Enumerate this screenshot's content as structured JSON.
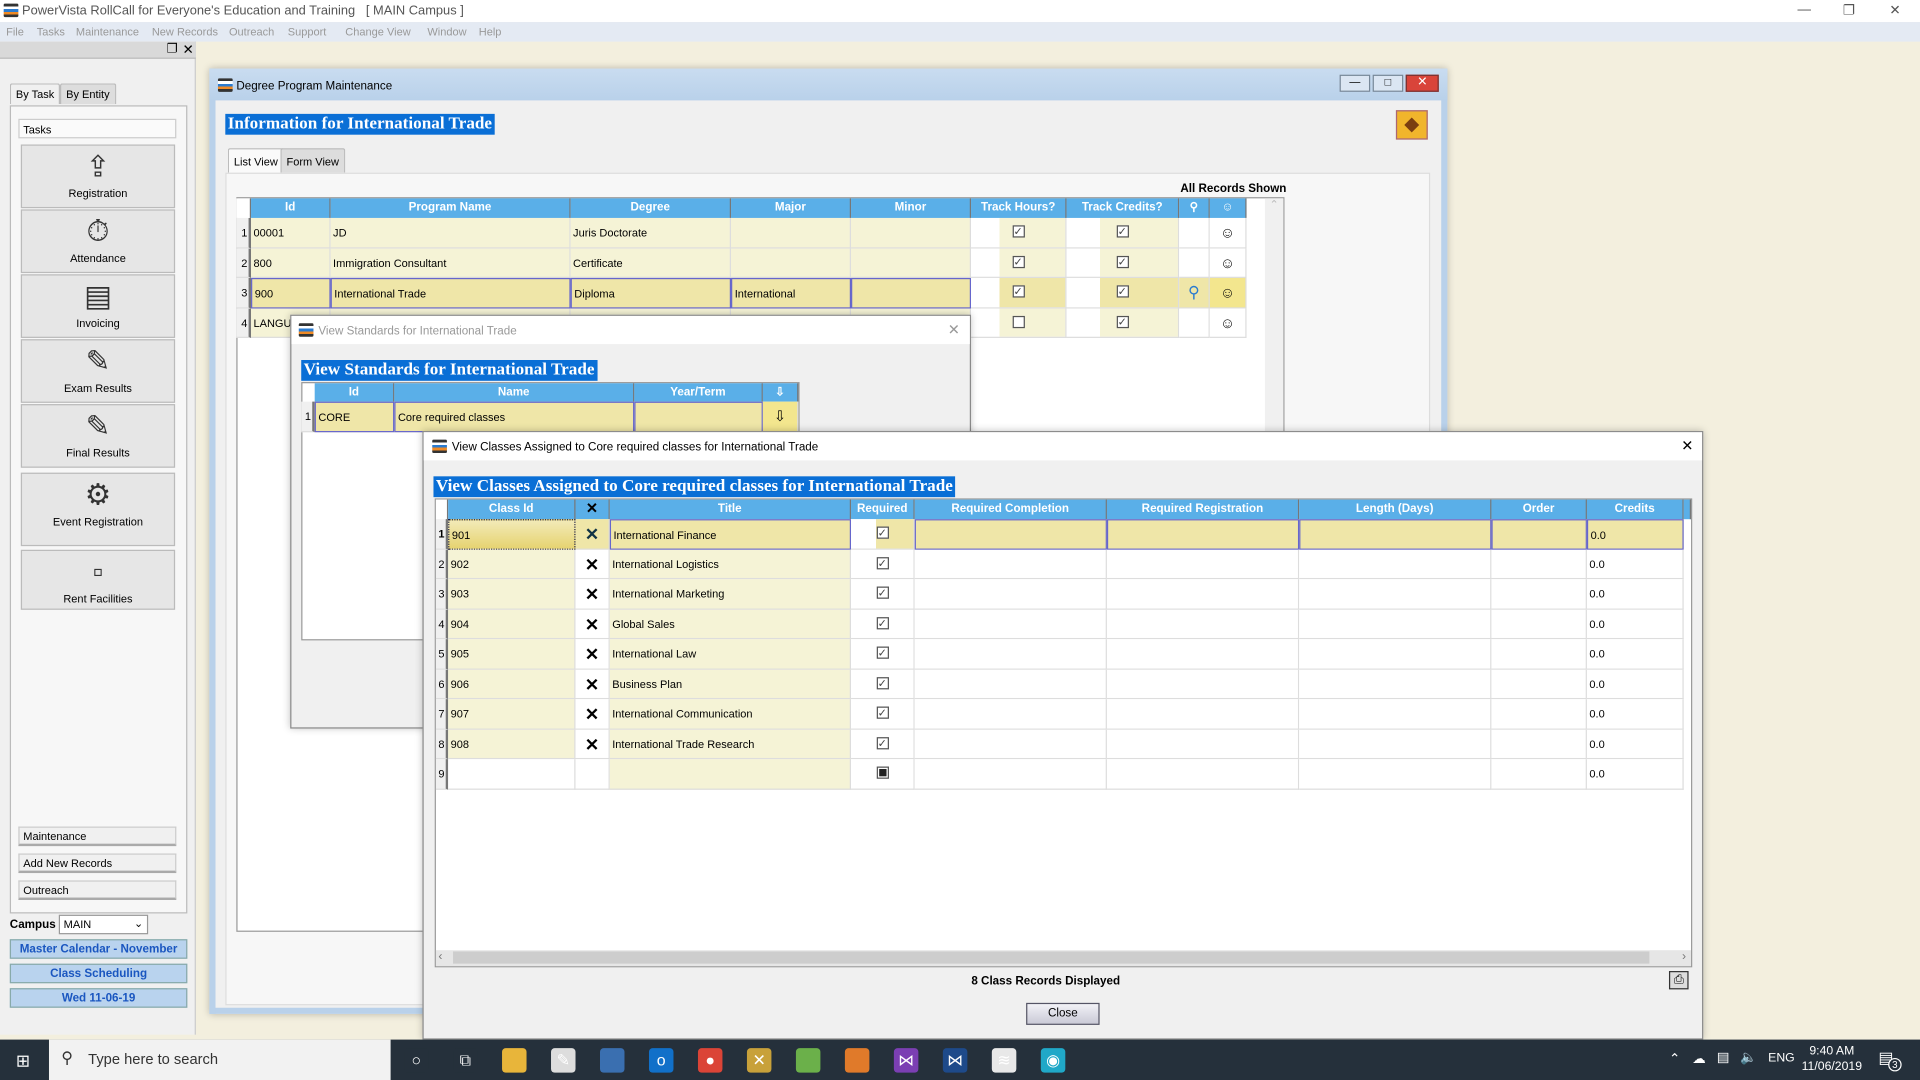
{
  "app": {
    "title": "PowerVista RollCall for Everyone's Education and Training",
    "campus_tag": "[ MAIN Campus ]"
  },
  "menu": [
    "File",
    "Tasks",
    "Maintenance",
    "New Records",
    "Outreach",
    "Support",
    "Change View",
    "Window",
    "Help"
  ],
  "sidebar": {
    "tabs": [
      "By Task",
      "By Entity"
    ],
    "tasks_header": "Tasks",
    "tasks": [
      {
        "label": "Registration",
        "icon": "registration-icon"
      },
      {
        "label": "Attendance",
        "icon": "attendance-icon"
      },
      {
        "label": "Invoicing",
        "icon": "invoice-icon"
      },
      {
        "label": "Exam Results",
        "icon": "exam-results-icon"
      },
      {
        "label": "Final Results",
        "icon": "final-results-icon"
      },
      {
        "label": "Event Registration",
        "icon": "event-registration-icon"
      },
      {
        "label": "Rent Facilities",
        "icon": "rent-facilities-icon"
      }
    ],
    "links": [
      "Maintenance",
      "Add New Records",
      "Outreach"
    ],
    "campus_label": "Campus",
    "campus_value": "MAIN",
    "buttons": [
      "Master Calendar - November",
      "Class Scheduling",
      "Wed 11-06-19"
    ]
  },
  "degree_window": {
    "title": "Degree Program Maintenance",
    "heading": "Information for International Trade",
    "tabs": [
      "List View",
      "Form View"
    ],
    "status": "All Records Shown",
    "columns": [
      "Id",
      "Program Name",
      "Degree",
      "Major",
      "Minor",
      "Track Hours?",
      "Track Credits?"
    ],
    "rows": [
      {
        "n": "1",
        "id": "00001",
        "name": "JD",
        "degree": "Juris Doctorate",
        "major": "",
        "minor": "",
        "hours": true,
        "credits": true
      },
      {
        "n": "2",
        "id": "800",
        "name": "Immigration Consultant",
        "degree": "Certificate",
        "major": "",
        "minor": "",
        "hours": true,
        "credits": true
      },
      {
        "n": "3",
        "id": "900",
        "name": "International Trade",
        "degree": "Diploma",
        "major": "International",
        "minor": "",
        "hours": true,
        "credits": true
      },
      {
        "n": "4",
        "id": "LANGUA",
        "name": "",
        "degree": "",
        "major": "",
        "minor": "",
        "hours": false,
        "credits": true
      }
    ],
    "selected_row": 3
  },
  "standards_window": {
    "title": "View Standards for International Trade",
    "heading": "View Standards for International Trade",
    "columns": [
      "Id",
      "Name",
      "Year/Term"
    ],
    "rows": [
      {
        "n": "1",
        "id": "CORE",
        "name": "Core required classes",
        "term": ""
      }
    ]
  },
  "classes_window": {
    "title": "View Classes Assigned to Core required classes for International Trade",
    "heading": "View Classes Assigned to Core required classes for International Trade",
    "columns": [
      "Class Id",
      "Title",
      "Required",
      "Required Completion",
      "Required Registration",
      "Length (Days)",
      "Order",
      "Credits"
    ],
    "rows": [
      {
        "n": "1",
        "id": "901",
        "title": "International Finance",
        "req": true,
        "credits": "0.0"
      },
      {
        "n": "2",
        "id": "902",
        "title": "International Logistics",
        "req": true,
        "credits": "0.0"
      },
      {
        "n": "3",
        "id": "903",
        "title": "International Marketing",
        "req": true,
        "credits": "0.0"
      },
      {
        "n": "4",
        "id": "904",
        "title": "Global Sales",
        "req": true,
        "credits": "0.0"
      },
      {
        "n": "5",
        "id": "905",
        "title": "International Law",
        "req": true,
        "credits": "0.0"
      },
      {
        "n": "6",
        "id": "906",
        "title": "Business Plan",
        "req": true,
        "credits": "0.0"
      },
      {
        "n": "7",
        "id": "907",
        "title": "International Communication",
        "req": true,
        "credits": "0.0"
      },
      {
        "n": "8",
        "id": "908",
        "title": "International Trade Research",
        "req": true,
        "credits": "0.0"
      },
      {
        "n": "9",
        "id": "",
        "title": "",
        "req": null,
        "credits": "0.0"
      }
    ],
    "status": "8 Class Records Displayed",
    "close_label": "Close"
  },
  "taskbar": {
    "search_placeholder": "Type here to search",
    "lang": "ENG",
    "time": "9:40 AM",
    "date": "11/06/2019",
    "notifications": "3"
  },
  "colors": {
    "header_blue": "#5aafe8",
    "highlight": "#0a6fd6",
    "row_yellow": "#f5f3d6",
    "selected_yellow": "#efe6a8"
  }
}
